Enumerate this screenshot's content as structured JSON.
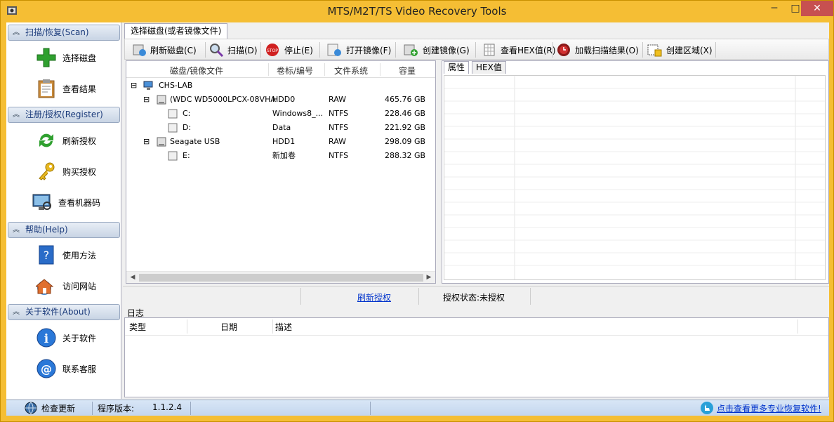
{
  "window": {
    "title": "MTS/M2T/TS Video Recovery Tools",
    "min": "─",
    "max": "□",
    "close": "✕"
  },
  "sidebar": {
    "sections": [
      {
        "title": "扫描/恢复(Scan)",
        "items": [
          {
            "label": "选择磁盘",
            "icon": "plus-icon"
          },
          {
            "label": "查看结果",
            "icon": "clipboard-icon"
          }
        ]
      },
      {
        "title": "注册/授权(Register)",
        "items": [
          {
            "label": "刷新授权",
            "icon": "refresh-icon"
          },
          {
            "label": "购买授权",
            "icon": "key-icon"
          },
          {
            "label": "查看机器码",
            "icon": "monitor-icon"
          }
        ]
      },
      {
        "title": "帮助(Help)",
        "items": [
          {
            "label": "使用方法",
            "icon": "help-book-icon"
          },
          {
            "label": "访问网站",
            "icon": "home-icon"
          }
        ]
      },
      {
        "title": "关于软件(About)",
        "items": [
          {
            "label": "关于软件",
            "icon": "info-icon"
          },
          {
            "label": "联系客服",
            "icon": "at-icon"
          }
        ]
      }
    ]
  },
  "main_tab": "选择磁盘(或者镜像文件)",
  "toolbar": {
    "refresh": "刷新磁盘(C)",
    "scan": "扫描(D)",
    "stop": "停止(E)",
    "open_image": "打开镜像(F)",
    "create_image": "创建镜像(G)",
    "view_hex": "查看HEX值(R)",
    "load_result": "加载扫描结果(O)",
    "create_region": "创建区域(X)"
  },
  "tree": {
    "headers": {
      "name": "磁盘/镜像文件",
      "label": "卷标/编号",
      "fs": "文件系统",
      "size": "容量"
    },
    "root": "CHS-LAB",
    "rows": [
      {
        "name": "(WDC WD5000LPCX-08VHA",
        "label": "HDD0",
        "fs": "RAW",
        "size": "465.76 GB"
      },
      {
        "name": "C:",
        "label": "Windows8_...",
        "fs": "NTFS",
        "size": "228.46 GB"
      },
      {
        "name": "D:",
        "label": "Data",
        "fs": "NTFS",
        "size": "221.92 GB"
      },
      {
        "name": "Seagate USB",
        "label": "HDD1",
        "fs": "RAW",
        "size": "298.09 GB"
      },
      {
        "name": "E:",
        "label": "新加卷",
        "fs": "NTFS",
        "size": "288.32 GB"
      }
    ],
    "expand_symbol": "⊟"
  },
  "props": {
    "tab_attr": "属性",
    "tab_hex": "HEX值"
  },
  "status_mid": {
    "refresh_link": "刷新授权",
    "auth_status": "授权状态:未授权"
  },
  "log": {
    "title": "日志",
    "headers": {
      "type": "类型",
      "date": "日期",
      "desc": "描述"
    }
  },
  "bottom": {
    "check_update": "检查更新",
    "version_label": "程序版本:",
    "version": "1.1.2.4",
    "more_link": "点击查看更多专业恢复软件!"
  }
}
